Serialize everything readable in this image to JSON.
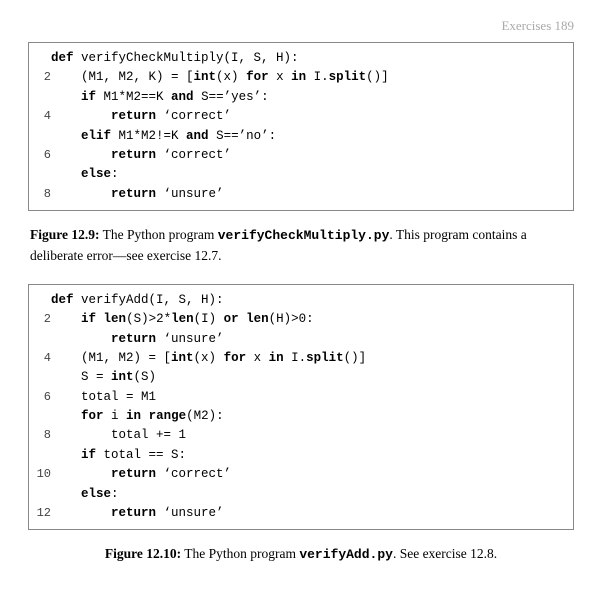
{
  "header": {
    "page_ref": "Exercises   189"
  },
  "figure1": {
    "caption_label": "Figure 12.9:",
    "caption_text": " The Python program ",
    "caption_code": "verifyCheckMultiply.py",
    "caption_rest": ". This program contains a deliberate error—see exercise 12.7.",
    "lines": [
      {
        "num": "",
        "code": "def verifyCheckMultiply(I, S, H):"
      },
      {
        "num": "2",
        "code": "    (M1, M2, K) = [int(x) for x in I.split()]"
      },
      {
        "num": "",
        "code": "    if M1*M2==K and S==’yes’:"
      },
      {
        "num": "4",
        "code": "        return ‘correct’"
      },
      {
        "num": "",
        "code": "    elif M1*M2!=K and S==’no’:"
      },
      {
        "num": "6",
        "code": "        return ‘correct’"
      },
      {
        "num": "",
        "code": "    else:"
      },
      {
        "num": "8",
        "code": "        return ‘unsure’"
      }
    ]
  },
  "figure2": {
    "caption_label": "Figure 12.10:",
    "caption_text": "  The Python program ",
    "caption_code": "verifyAdd.py",
    "caption_rest": ". See exercise 12.8.",
    "lines": [
      {
        "num": "",
        "code": "def verifyAdd(I, S, H):"
      },
      {
        "num": "2",
        "code": "    if len(S)>2*len(I) or len(H)>0:"
      },
      {
        "num": "",
        "code": "        return ‘unsure’"
      },
      {
        "num": "4",
        "code": "    (M1, M2) = [int(x) for x in I.split()]"
      },
      {
        "num": "",
        "code": "    S = int(S)"
      },
      {
        "num": "6",
        "code": "    total = M1"
      },
      {
        "num": "",
        "code": "    for i in range(M2):"
      },
      {
        "num": "8",
        "code": "        total += 1"
      },
      {
        "num": "",
        "code": "    if total == S:"
      },
      {
        "num": "10",
        "code": "        return ‘correct’"
      },
      {
        "num": "",
        "code": "    else:"
      },
      {
        "num": "12",
        "code": "        return ‘unsure’"
      }
    ]
  }
}
